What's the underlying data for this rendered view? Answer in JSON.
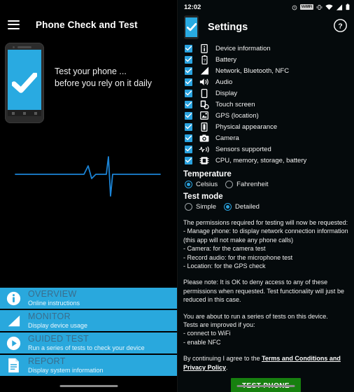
{
  "left": {
    "app_title": "Phone Check and Test",
    "menu_icon": "hamburger-menu-icon",
    "hero": {
      "phone_icon": "phone-with-checkmark-illustration",
      "line1": "Test your phone ...",
      "line2": "before you rely on it daily",
      "ecg": "heartbeat-waveform"
    },
    "menu": [
      {
        "icon": "info-icon",
        "title": "OVERVIEW",
        "subtitle": "Online instructions"
      },
      {
        "icon": "signal-bars-icon",
        "title": "MONITOR",
        "subtitle": "Display device usage"
      },
      {
        "icon": "play-circle-icon",
        "title": "GUIDED TEST",
        "subtitle": "Run a series of tests to check your device"
      },
      {
        "icon": "document-icon",
        "title": "REPORT",
        "subtitle": "Display system information"
      }
    ]
  },
  "right": {
    "status_bar": {
      "time": "12:02",
      "sim_label": "VoWiFi",
      "icons": [
        "alarm-icon",
        "vowifi-badge-icon",
        "vibrate-icon",
        "wifi-icon",
        "cellular-signal-icon",
        "battery-icon"
      ]
    },
    "header": {
      "logo": "phone-with-checkmark-icon",
      "title": "Settings",
      "help": "help-question-icon"
    },
    "checklist": [
      {
        "icon": "device-info-icon",
        "label": "Device information",
        "checked": true
      },
      {
        "icon": "battery-icon",
        "label": "Battery",
        "checked": true
      },
      {
        "icon": "signal-bars-icon",
        "label": "Network, Bluetooth, NFC",
        "checked": true
      },
      {
        "icon": "audio-speaker-icon",
        "label": "Audio",
        "checked": true
      },
      {
        "icon": "display-icon",
        "label": "Display",
        "checked": true
      },
      {
        "icon": "touch-screen-icon",
        "label": "Touch screen",
        "checked": true
      },
      {
        "icon": "gps-location-icon",
        "label": "GPS (location)",
        "checked": true
      },
      {
        "icon": "physical-appearance-icon",
        "label": "Physical appearance",
        "checked": true
      },
      {
        "icon": "camera-icon",
        "label": "Camera",
        "checked": true
      },
      {
        "icon": "sensors-icon",
        "label": "Sensors supported",
        "checked": true
      },
      {
        "icon": "cpu-memory-icon",
        "label": "CPU, memory, storage, battery",
        "checked": true
      }
    ],
    "temperature": {
      "heading": "Temperature",
      "options": [
        {
          "label": "Celsius",
          "selected": true
        },
        {
          "label": "Fahrenheit",
          "selected": false
        }
      ]
    },
    "test_mode": {
      "heading": "Test mode",
      "options": [
        {
          "label": "Simple",
          "selected": false
        },
        {
          "label": "Detailed",
          "selected": true
        }
      ]
    },
    "info": {
      "block1": "The permissions required for testing will now be requested:\n- Manage phone: to display network connection information\n(this app will not make any phone calls)\n- Camera: for the camera test\n- Record audio: for the microphone test\n- Location: for the GPS check",
      "block2": "Please note: It is OK to deny access to any of these permissions when requested. Test functionality will just be reduced in this case.",
      "block3": "You are about to run a series of tests on this device.\nTests are improved if you:\n- connect to WiFi\n- enable NFC",
      "agree_prefix": "By continuing I agree to the ",
      "agree_link": "Terms and Conditions and Privacy Policy",
      "agree_suffix": "."
    },
    "test_button": "TEST PHONE"
  },
  "colors": {
    "accent_blue": "#29a8dd",
    "checkbox_blue": "#2aa3e0",
    "button_green": "#17800f",
    "background": "#000000",
    "menu_title": "#3a6d8c"
  }
}
